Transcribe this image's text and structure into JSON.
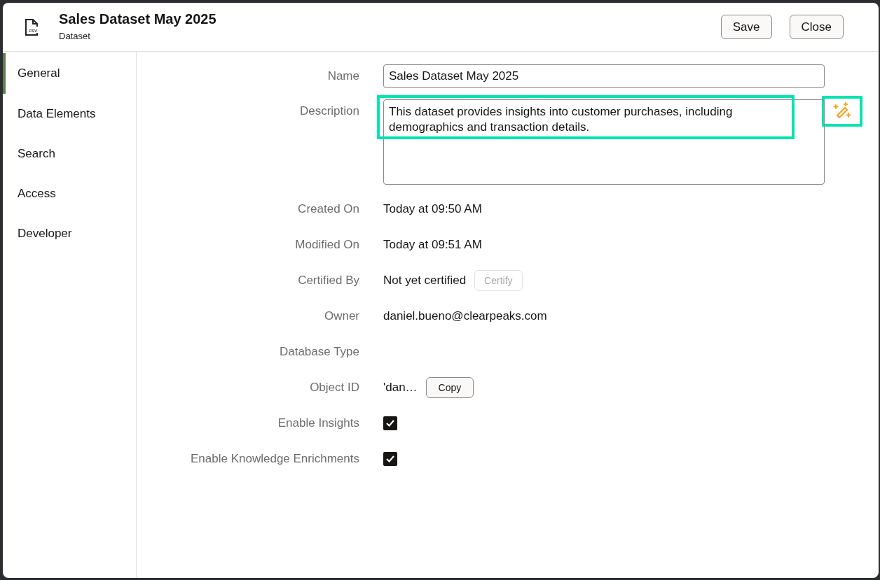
{
  "header": {
    "icon_text": "csv",
    "title": "Sales Dataset May 2025",
    "subtitle": "Dataset",
    "buttons": [
      "Save",
      "Close"
    ]
  },
  "sidebar": {
    "items": [
      {
        "label": "General",
        "selected": true
      },
      {
        "label": "Data Elements",
        "selected": false
      },
      {
        "label": "Search",
        "selected": false
      },
      {
        "label": "Access",
        "selected": false
      },
      {
        "label": "Developer",
        "selected": false
      }
    ]
  },
  "fields": [
    {
      "kind": "input",
      "label": "Name",
      "value": "Sales Dataset May 2025"
    },
    {
      "kind": "textarea",
      "label": "Description",
      "value": "This dataset provides insights into customer purchases, including demographics and transaction details."
    },
    {
      "kind": "text",
      "label": "Created On",
      "value": "Today at 09:50 AM"
    },
    {
      "kind": "text",
      "label": "Modified On",
      "value": "Today at 09:51 AM"
    },
    {
      "kind": "text_button",
      "label": "Certified By",
      "value": "Not yet certified",
      "button": {
        "label": "Certify",
        "disabled": true
      }
    },
    {
      "kind": "text",
      "label": "Owner",
      "value": "daniel.bueno@clearpeaks.com"
    },
    {
      "kind": "text",
      "label": "Database Type"
    },
    {
      "kind": "text_button",
      "label": "Object ID",
      "value": "'dan…",
      "button": {
        "label": "Copy",
        "disabled": false
      }
    },
    {
      "kind": "checkbox",
      "label": "Enable Insights",
      "checked": true
    },
    {
      "kind": "checkbox",
      "label": "Enable Knowledge Enrichments",
      "checked": true
    }
  ]
}
